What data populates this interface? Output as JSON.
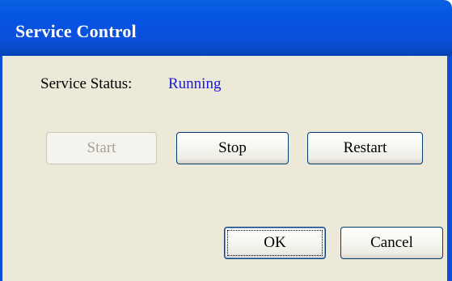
{
  "window": {
    "title": "Service Control"
  },
  "status": {
    "label": "Service Status:",
    "value": "Running",
    "value_color": "#1a1ad6"
  },
  "controls": {
    "start_label": "Start",
    "start_enabled": false,
    "stop_label": "Stop",
    "restart_label": "Restart"
  },
  "dialog_buttons": {
    "ok_label": "OK",
    "cancel_label": "Cancel",
    "default_button": "OK"
  },
  "colors": {
    "titlebar": "#0554e3",
    "client_background": "#ece9d8"
  }
}
